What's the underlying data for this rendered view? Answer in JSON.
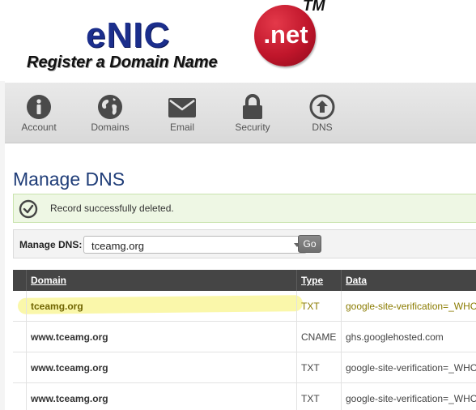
{
  "logo": {
    "brand": "eNIC",
    "tagline": "Register a Domain Name",
    "suffix": ".net",
    "trademark": "TM"
  },
  "nav": {
    "items": [
      {
        "label": "Account",
        "icon": "info-icon"
      },
      {
        "label": "Domains",
        "icon": "globe-icon"
      },
      {
        "label": "Email",
        "icon": "envelope-icon"
      },
      {
        "label": "Security",
        "icon": "lock-icon"
      },
      {
        "label": "DNS",
        "icon": "upload-circle-icon"
      }
    ]
  },
  "page": {
    "title": "Manage DNS"
  },
  "alert": {
    "message": "Record successfully deleted.",
    "icon": "check-circle-icon"
  },
  "manage": {
    "label": "Manage DNS:",
    "selected_domain": "tceamg.org",
    "go_label": "Go"
  },
  "table": {
    "headers": {
      "domain": "Domain",
      "type": "Type",
      "data": "Data"
    },
    "rows": [
      {
        "domain": "tceamg.org",
        "type": "TXT",
        "data": "google-site-verification=_WHC",
        "highlighted": true
      },
      {
        "domain": "www.tceamg.org",
        "type": "CNAME",
        "data": "ghs.googlehosted.com",
        "highlighted": false
      },
      {
        "domain": "www.tceamg.org",
        "type": "TXT",
        "data": "google-site-verification=_WHC",
        "highlighted": false
      },
      {
        "domain": "www.tceamg.org",
        "type": "TXT",
        "data": "google-site-verification=_WHC",
        "highlighted": false
      }
    ]
  },
  "colors": {
    "title": "#1f3d78",
    "logo_blue": "#1b2e8c",
    "logo_red": "#c0162b",
    "alert_bg": "#eef7e4",
    "table_header_bg": "#454545",
    "highlight": "#f5f064"
  }
}
